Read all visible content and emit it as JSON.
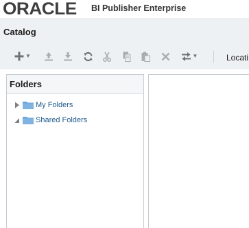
{
  "brand": {
    "logo": "ORACLE",
    "product": "BI Publisher Enterprise"
  },
  "page": {
    "title": "Catalog"
  },
  "toolbar": {
    "items": [
      {
        "name": "new",
        "icon": "plus-icon",
        "has_menu": true,
        "enabled": true
      },
      {
        "name": "upload",
        "icon": "upload-icon",
        "enabled": false
      },
      {
        "name": "download",
        "icon": "download-icon",
        "enabled": false
      },
      {
        "name": "refresh",
        "icon": "refresh-icon",
        "enabled": true
      },
      {
        "name": "cut",
        "icon": "scissors-icon",
        "enabled": false
      },
      {
        "name": "copy",
        "icon": "copy-icon",
        "enabled": false
      },
      {
        "name": "paste",
        "icon": "paste-icon",
        "enabled": false
      },
      {
        "name": "delete",
        "icon": "delete-x-icon",
        "enabled": false
      },
      {
        "name": "move",
        "icon": "swap-arrows-icon",
        "has_menu": true,
        "enabled": true
      }
    ],
    "location_label": "Locati"
  },
  "folders_pane": {
    "title": "Folders",
    "items": [
      {
        "label": "My Folders",
        "expanded": false
      },
      {
        "label": "Shared Folders",
        "expanded": true
      }
    ]
  },
  "colors": {
    "header_band": "#eef1f4",
    "link": "#1f5a8c",
    "folder": "#6aa6d8",
    "border": "#c5ccd3"
  }
}
